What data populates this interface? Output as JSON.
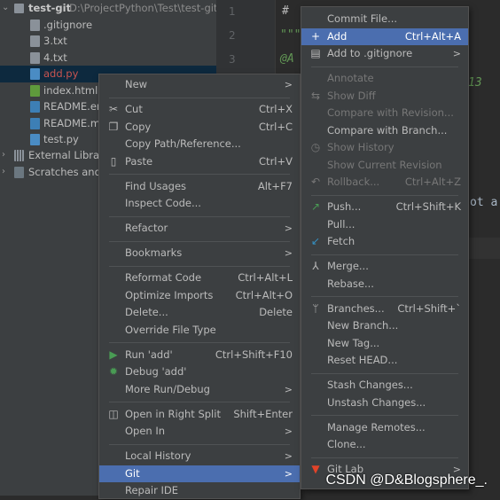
{
  "project": {
    "root": {
      "name": "test-git",
      "path": "D:\\ProjectPython\\Test\\test-git"
    },
    "files": [
      {
        "name": ".gitignore",
        "type": "gitignore"
      },
      {
        "name": "3.txt",
        "type": "text"
      },
      {
        "name": "4.txt",
        "type": "text"
      },
      {
        "name": "add.py",
        "type": "python",
        "selected": true,
        "color": "#c75450"
      },
      {
        "name": "index.html",
        "type": "html"
      },
      {
        "name": "README.en",
        "type": "markdown"
      },
      {
        "name": "README.md",
        "type": "markdown"
      },
      {
        "name": "test.py",
        "type": "python"
      }
    ],
    "external": "External Libraries",
    "scratches": "Scratches and Consoles"
  },
  "editor": {
    "line_numbers": [
      "1",
      "2",
      "3"
    ],
    "lines": [
      "#",
      "\"\"\"",
      "@A"
    ],
    "fragment_13": "13",
    "fragment_ot": "ot a"
  },
  "context_menu": [
    {
      "label": "New",
      "submenu": true
    },
    {
      "sep": true
    },
    {
      "label": "Cut",
      "shortcut": "Ctrl+X",
      "icon": "scissors-icon",
      "glyph": "✂"
    },
    {
      "label": "Copy",
      "shortcut": "Ctrl+C",
      "icon": "copy-icon",
      "glyph": "❐"
    },
    {
      "label": "Copy Path/Reference..."
    },
    {
      "label": "Paste",
      "shortcut": "Ctrl+V",
      "icon": "clipboard-icon",
      "glyph": "▯"
    },
    {
      "sep": true
    },
    {
      "label": "Find Usages",
      "shortcut": "Alt+F7"
    },
    {
      "label": "Inspect Code..."
    },
    {
      "sep": true
    },
    {
      "label": "Refactor",
      "submenu": true
    },
    {
      "sep": true
    },
    {
      "label": "Bookmarks",
      "submenu": true
    },
    {
      "sep": true
    },
    {
      "label": "Reformat Code",
      "shortcut": "Ctrl+Alt+L"
    },
    {
      "label": "Optimize Imports",
      "shortcut": "Ctrl+Alt+O"
    },
    {
      "label": "Delete...",
      "shortcut": "Delete"
    },
    {
      "label": "Override File Type"
    },
    {
      "sep": true
    },
    {
      "label": "Run 'add'",
      "shortcut": "Ctrl+Shift+F10",
      "icon": "run-icon",
      "glyph": "▶",
      "color": "#499c54"
    },
    {
      "label": "Debug 'add'",
      "icon": "debug-bug-icon",
      "glyph": "✹",
      "color": "#499c54"
    },
    {
      "label": "More Run/Debug",
      "submenu": true
    },
    {
      "sep": true
    },
    {
      "label": "Open in Right Split",
      "shortcut": "Shift+Enter",
      "icon": "split-icon",
      "glyph": "◫"
    },
    {
      "label": "Open In",
      "submenu": true
    },
    {
      "sep": true
    },
    {
      "label": "Local History",
      "submenu": true
    },
    {
      "label": "Git",
      "submenu": true,
      "highlighted": true
    },
    {
      "label": "Repair IDE"
    }
  ],
  "git_menu": [
    {
      "label": "Commit File..."
    },
    {
      "label": "Add",
      "shortcut": "Ctrl+Alt+A",
      "highlighted": true,
      "icon": "plus-icon",
      "glyph": "+"
    },
    {
      "label": "Add to .gitignore",
      "submenu": true,
      "icon": "gitignore-icon",
      "glyph": "▤"
    },
    {
      "sep": true
    },
    {
      "label": "Annotate",
      "disabled": true
    },
    {
      "label": "Show Diff",
      "disabled": true,
      "icon": "diff-icon",
      "glyph": "⇆"
    },
    {
      "label": "Compare with Revision...",
      "disabled": true
    },
    {
      "label": "Compare with Branch..."
    },
    {
      "label": "Show History",
      "disabled": true,
      "icon": "clock-icon",
      "glyph": "◷"
    },
    {
      "label": "Show Current Revision",
      "disabled": true
    },
    {
      "label": "Rollback...",
      "shortcut": "Ctrl+Alt+Z",
      "disabled": true,
      "icon": "rollback-icon",
      "glyph": "↶"
    },
    {
      "sep": true
    },
    {
      "label": "Push...",
      "shortcut": "Ctrl+Shift+K",
      "icon": "push-arrow-icon",
      "glyph": "↗",
      "color": "#499c54"
    },
    {
      "label": "Pull..."
    },
    {
      "label": "Fetch",
      "icon": "fetch-icon",
      "glyph": "↙",
      "color": "#3592c4"
    },
    {
      "sep": true
    },
    {
      "label": "Merge...",
      "icon": "merge-icon",
      "glyph": "⅄"
    },
    {
      "label": "Rebase..."
    },
    {
      "sep": true
    },
    {
      "label": "Branches...",
      "shortcut": "Ctrl+Shift+`",
      "icon": "branch-icon",
      "glyph": "ᛘ"
    },
    {
      "label": "New Branch..."
    },
    {
      "label": "New Tag..."
    },
    {
      "label": "Reset HEAD..."
    },
    {
      "sep": true
    },
    {
      "label": "Stash Changes..."
    },
    {
      "label": "Unstash Changes..."
    },
    {
      "sep": true
    },
    {
      "label": "Manage Remotes..."
    },
    {
      "label": "Clone..."
    },
    {
      "sep": true
    },
    {
      "label": "Git Lab",
      "submenu": true,
      "icon": "gitlab-icon",
      "glyph": "▼",
      "color": "#e24329"
    }
  ],
  "submenu_arrow": ">",
  "watermark": "CSDN @D&Blogsphere_.",
  "colors": {
    "highlight": "#4b6eaf",
    "selected_row": "#0d293e",
    "menu_bg": "#3c3f41",
    "editor_bg": "#2b2b2b"
  }
}
